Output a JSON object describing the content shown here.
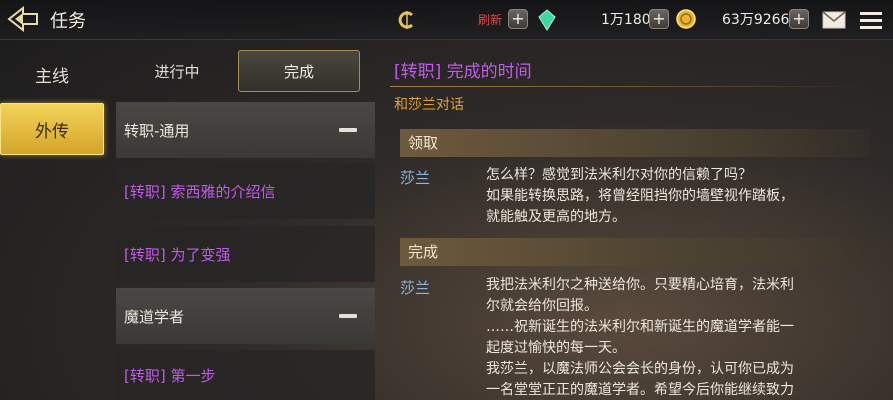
{
  "header": {
    "title": "任务",
    "refresh_label": "刷新",
    "currency1": "1万180",
    "currency2": "63万9266",
    "back_icon": "back-arrow-icon"
  },
  "sidebar": {
    "tabs": [
      {
        "label": "主线",
        "active": false
      },
      {
        "label": "外传",
        "active": true
      }
    ]
  },
  "status_tabs": [
    {
      "label": "进行中",
      "active": false
    },
    {
      "label": "完成",
      "active": true
    }
  ],
  "quests": [
    {
      "label": "转职-通用",
      "type": "group"
    },
    {
      "label": "[转职] 索西雅的介绍信",
      "type": "item"
    },
    {
      "label": "[转职] 为了变强",
      "type": "item"
    },
    {
      "label": "魔道学者",
      "type": "group"
    },
    {
      "label": "[转职] 第一步",
      "type": "item"
    }
  ],
  "detail": {
    "title": "[转职] 完成的时间",
    "subtitle": "和莎兰对话",
    "sections": [
      {
        "header": "领取",
        "speaker": "莎兰",
        "lines": [
          "怎么样？感觉到法米利尔对你的信赖了吗？",
          "如果能转换思路，将曾经阻挡你的墙壁视作踏板，",
          "就能触及更高的地方。"
        ]
      },
      {
        "header": "完成",
        "speaker": "莎兰",
        "lines": [
          "我把法米利尔之种送给你。只要精心培育，法米利",
          "尔就会给你回报。",
          "……祝新诞生的法米利尔和新诞生的魔道学者能一",
          "起度过愉快的每一天。",
          "我莎兰，以魔法师公会会长的身份，认可你已成为",
          "一名堂堂正正的魔道学者。希望今后你能继续致力"
        ]
      }
    ]
  },
  "colors": {
    "accent_gold": "#f2d35a",
    "quest_purple": "#c05ae8",
    "subtitle_orange": "#e0a23a",
    "speaker_blue": "#8fb6d9",
    "refresh_red": "#e04848"
  }
}
